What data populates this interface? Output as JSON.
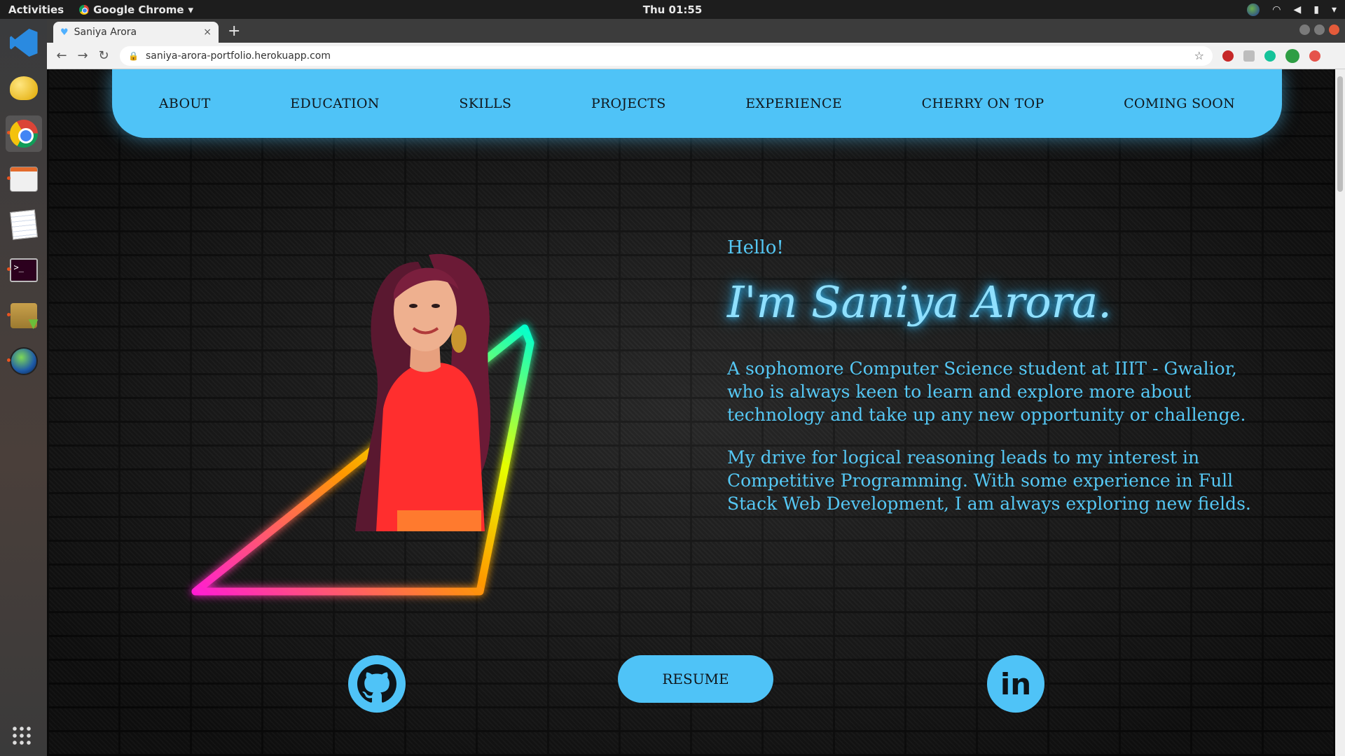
{
  "system_bar": {
    "activities": "Activities",
    "app_name": "Google Chrome",
    "app_menu_arrow": "▾",
    "clock": "Thu 01:55"
  },
  "dock": {
    "items": [
      "vscode-icon",
      "teapot-icon",
      "chrome-icon",
      "files-icon",
      "text-editor-icon",
      "terminal-icon",
      "archive-icon",
      "globe-icon"
    ],
    "terminal_prompt": ">_"
  },
  "browser": {
    "tab_title": "Saniya Arora",
    "tab_close": "×",
    "new_tab": "+",
    "url": "saniya-arora-portfolio.herokuapp.com",
    "back": "←",
    "forward": "→",
    "reload": "↻",
    "star": "☆",
    "lock": "🔒",
    "tab_favicon": "♥"
  },
  "nav": {
    "links": [
      "ABOUT",
      "EDUCATION",
      "SKILLS",
      "PROJECTS",
      "EXPERIENCE",
      "CHERRY ON TOP",
      "COMING SOON"
    ]
  },
  "intro": {
    "greeting": "Hello!",
    "name": "I'm Saniya Arora.",
    "para1": "A sophomore Computer Science student at IIIT - Gwalior, who is always keen to learn and explore more about technology and take up any new opportunity or challenge.",
    "para2": "My drive for logical reasoning leads to my interest in Competitive Programming. With some experience in Full Stack Web Development, I am always exploring new fields."
  },
  "actions": {
    "resume": "RESUME",
    "linkedin": "in"
  },
  "colors": {
    "accent": "#4fc3f7",
    "name_glow": "#2fb8f5"
  }
}
